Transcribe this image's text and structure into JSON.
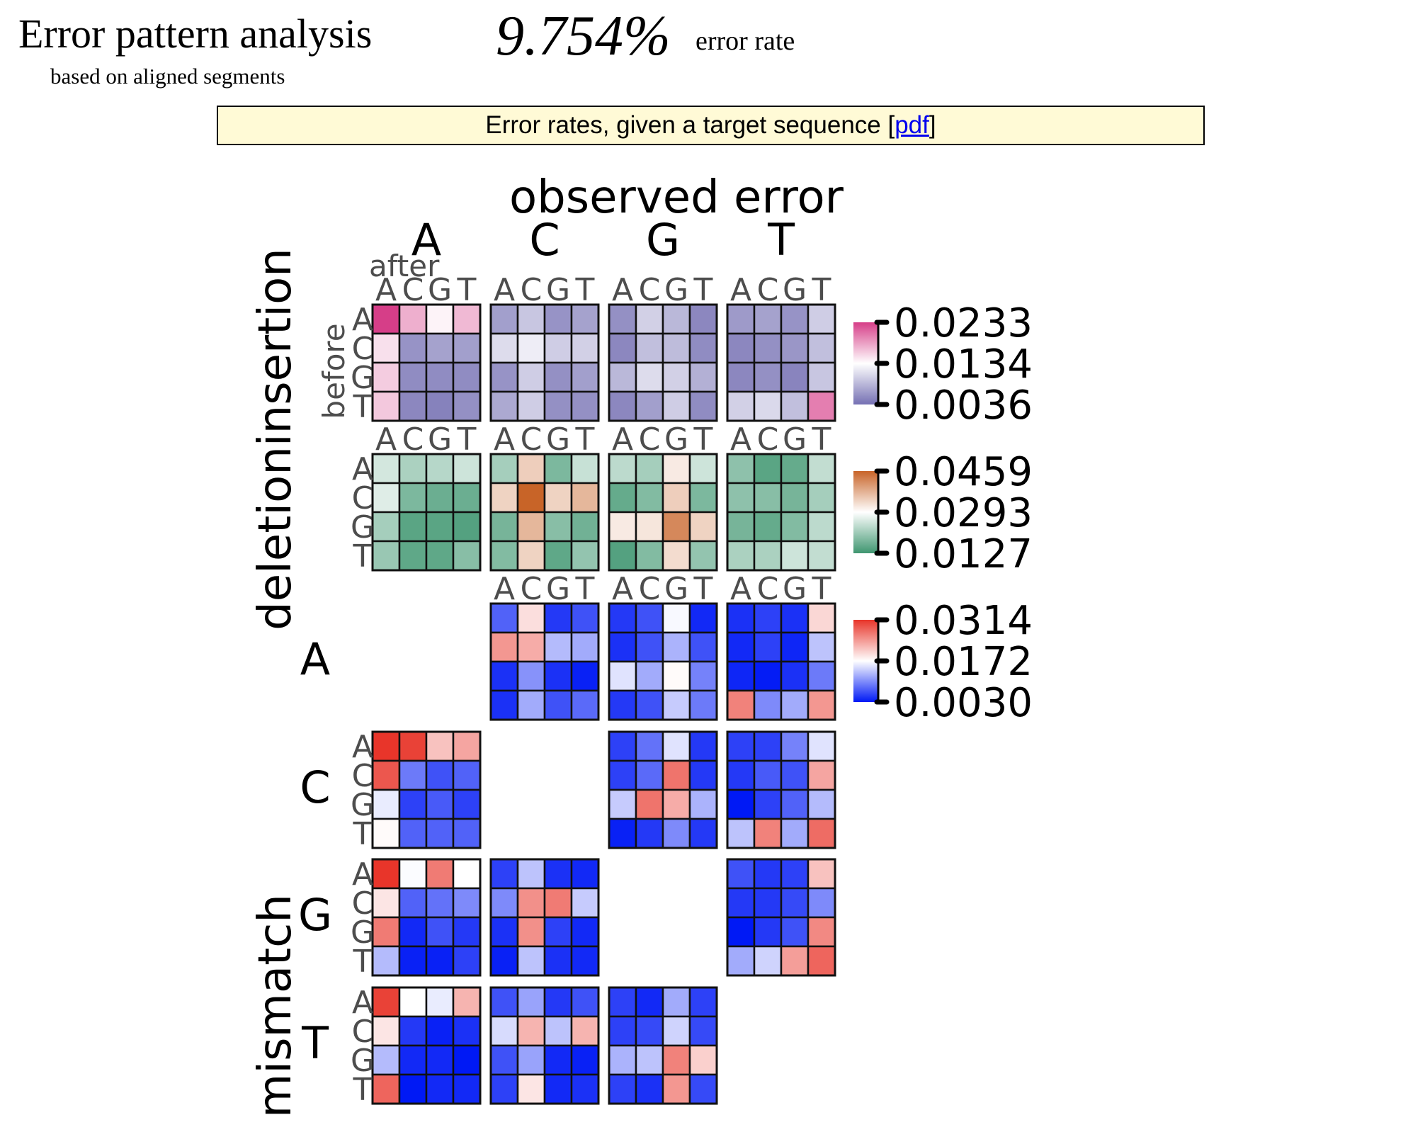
{
  "header": {
    "title": "Error pattern analysis",
    "subtitle": "based on aligned segments",
    "error_rate_value": "9.754%",
    "error_rate_label": "error rate"
  },
  "banner": {
    "text_before": "Error rates, given a target sequence [",
    "link_label": "pdf",
    "text_after": "]"
  },
  "chart_data": {
    "type": "heatmap",
    "title": "observed error",
    "column_labels": [
      "A",
      "C",
      "G",
      "T"
    ],
    "column_axis_label": "after",
    "row_axis_label": "before",
    "bases": [
      "A",
      "C",
      "G",
      "T"
    ],
    "row_groups": [
      {
        "name": "insertion",
        "group_label": "insertion"
      },
      {
        "name": "deletion",
        "group_label": "deletion"
      },
      {
        "name": "mismatch A",
        "group_label": "mismatch",
        "sub_label": "A"
      },
      {
        "name": "mismatch C",
        "group_label": "mismatch",
        "sub_label": "C"
      },
      {
        "name": "mismatch G",
        "group_label": "mismatch",
        "sub_label": "G"
      },
      {
        "name": "mismatch T",
        "group_label": "mismatch",
        "sub_label": "T"
      }
    ],
    "side_labels": {
      "top": "deletioninsertion",
      "bottom": "mismatch"
    },
    "scales": {
      "insertion": {
        "min": 0.0036,
        "mid": 0.0134,
        "max": 0.0233,
        "low_color": "#7570b3",
        "mid_color": "#ffffff",
        "high_color": "#d63e88",
        "ticks": [
          "0.0233",
          "0.0134",
          "0.0036"
        ]
      },
      "deletion": {
        "min": 0.0127,
        "mid": 0.0293,
        "max": 0.0459,
        "low_color": "#3f9670",
        "mid_color": "#ffffff",
        "high_color": "#c86428",
        "ticks": [
          "0.0459",
          "0.0293",
          "0.0127"
        ]
      },
      "mismatch": {
        "min": 0.003,
        "mid": 0.0172,
        "max": 0.0314,
        "low_color": "#0019f5",
        "mid_color": "#ffffff",
        "high_color": "#e8352a",
        "ticks": [
          "0.0314",
          "0.0172",
          "0.0030"
        ]
      }
    },
    "panels": {
      "insertion": {
        "A": [
          [
            0.0233,
            0.0175,
            0.014,
            0.017
          ],
          [
            0.015,
            0.006,
            0.007,
            0.0068
          ],
          [
            0.016,
            0.0055,
            0.0055,
            0.0055
          ],
          [
            0.0162,
            0.0052,
            0.0048,
            0.0058
          ]
        ],
        "C": [
          [
            0.0068,
            0.0095,
            0.006,
            0.007
          ],
          [
            0.011,
            0.0122,
            0.01,
            0.0102
          ],
          [
            0.006,
            0.01,
            0.0058,
            0.0068
          ],
          [
            0.0075,
            0.01,
            0.0058,
            0.0058
          ]
        ],
        "G": [
          [
            0.0058,
            0.0102,
            0.0085,
            0.0052
          ],
          [
            0.0052,
            0.009,
            0.0088,
            0.0055
          ],
          [
            0.0085,
            0.011,
            0.0102,
            0.008
          ],
          [
            0.0052,
            0.0068,
            0.01,
            0.0055
          ]
        ],
        "T": [
          [
            0.0065,
            0.007,
            0.006,
            0.01
          ],
          [
            0.0052,
            0.0058,
            0.0062,
            0.009
          ],
          [
            0.0052,
            0.0058,
            0.005,
            0.0095
          ],
          [
            0.0102,
            0.0108,
            0.009,
            0.02
          ]
        ]
      },
      "deletion": {
        "A": [
          [
            0.0255,
            0.022,
            0.023,
            0.025
          ],
          [
            0.0265,
            0.018,
            0.0165,
            0.0165
          ],
          [
            0.0215,
            0.015,
            0.015,
            0.0145
          ],
          [
            0.0205,
            0.0155,
            0.0155,
            0.019
          ]
        ],
        "C": [
          [
            0.0215,
            0.0345,
            0.018,
            0.0245
          ],
          [
            0.034,
            0.0459,
            0.034,
            0.037
          ],
          [
            0.0175,
            0.037,
            0.019,
            0.017
          ],
          [
            0.0185,
            0.034,
            0.0155,
            0.02
          ]
        ],
        "G": [
          [
            0.0235,
            0.0215,
            0.0315,
            0.025
          ],
          [
            0.016,
            0.0185,
            0.0345,
            0.018
          ],
          [
            0.0315,
            0.032,
            0.042,
            0.034
          ],
          [
            0.0145,
            0.0185,
            0.033,
            0.02
          ]
        ],
        "T": [
          [
            0.0195,
            0.015,
            0.016,
            0.024
          ],
          [
            0.0195,
            0.019,
            0.0175,
            0.0215
          ],
          [
            0.0175,
            0.016,
            0.0185,
            0.0235
          ],
          [
            0.022,
            0.022,
            0.025,
            0.024
          ]
        ]
      },
      "mismatch A": {
        "A": null,
        "C": [
          [
            0.0075,
            0.0195,
            0.005,
            0.0065
          ],
          [
            0.0245,
            0.023,
            0.013,
            0.012
          ],
          [
            0.0045,
            0.0105,
            0.0045,
            0.0035
          ],
          [
            0.0045,
            0.012,
            0.0065,
            0.008
          ]
        ],
        "G": [
          [
            0.005,
            0.0065,
            0.0168,
            0.004
          ],
          [
            0.0045,
            0.0065,
            0.0125,
            0.0065
          ],
          [
            0.0155,
            0.012,
            0.0175,
            0.0095
          ],
          [
            0.005,
            0.0065,
            0.014,
            0.009
          ]
        ],
        "T": [
          [
            0.0045,
            0.0055,
            0.0045,
            0.02
          ],
          [
            0.004,
            0.0055,
            0.0038,
            0.0135
          ],
          [
            0.0038,
            0.0032,
            0.0045,
            0.009
          ],
          [
            0.026,
            0.01,
            0.012,
            0.0245
          ]
        ]
      },
      "mismatch C": {
        "A": [
          [
            0.0314,
            0.0305,
            0.0215,
            0.0235
          ],
          [
            0.029,
            0.009,
            0.0065,
            0.0075
          ],
          [
            0.016,
            0.0055,
            0.007,
            0.0055
          ],
          [
            0.0175,
            0.0075,
            0.0075,
            0.0075
          ]
        ],
        "C": null,
        "G": [
          [
            0.0055,
            0.0085,
            0.0155,
            0.005
          ],
          [
            0.0055,
            0.008,
            0.027,
            0.005
          ],
          [
            0.014,
            0.027,
            0.023,
            0.0125
          ],
          [
            0.0035,
            0.005,
            0.01,
            0.005
          ]
        ],
        "T": [
          [
            0.0055,
            0.0055,
            0.0095,
            0.0155
          ],
          [
            0.005,
            0.007,
            0.0065,
            0.0235
          ],
          [
            0.003,
            0.0055,
            0.0075,
            0.013
          ],
          [
            0.0135,
            0.026,
            0.012,
            0.0275
          ]
        ]
      },
      "mismatch G": {
        "A": [
          [
            0.0314,
            0.017,
            0.0265,
            0.0172
          ],
          [
            0.019,
            0.0075,
            0.0085,
            0.01
          ],
          [
            0.0265,
            0.004,
            0.0065,
            0.005
          ],
          [
            0.013,
            0.0035,
            0.0035,
            0.0055
          ]
        ],
        "C": [
          [
            0.0055,
            0.0135,
            0.0045,
            0.004
          ],
          [
            0.01,
            0.025,
            0.0265,
            0.014
          ],
          [
            0.0045,
            0.025,
            0.0055,
            0.004
          ],
          [
            0.0035,
            0.0135,
            0.0045,
            0.004
          ]
        ],
        "G": null,
        "T": [
          [
            0.0065,
            0.005,
            0.0055,
            0.0215
          ],
          [
            0.005,
            0.005,
            0.006,
            0.01
          ],
          [
            0.003,
            0.005,
            0.0065,
            0.0255
          ],
          [
            0.012,
            0.0145,
            0.024,
            0.028
          ]
        ]
      },
      "mismatch T": {
        "A": [
          [
            0.0305,
            0.0172,
            0.016,
            0.0225
          ],
          [
            0.019,
            0.005,
            0.0035,
            0.0045
          ],
          [
            0.013,
            0.004,
            0.004,
            0.003
          ],
          [
            0.028,
            0.003,
            0.004,
            0.004
          ]
        ],
        "C": [
          [
            0.0065,
            0.0115,
            0.005,
            0.0065
          ],
          [
            0.015,
            0.0225,
            0.0135,
            0.0225
          ],
          [
            0.0065,
            0.0115,
            0.004,
            0.0035
          ],
          [
            0.0055,
            0.019,
            0.004,
            0.0045
          ]
        ],
        "G": [
          [
            0.0055,
            0.004,
            0.012,
            0.0055
          ],
          [
            0.0055,
            0.006,
            0.0145,
            0.006
          ],
          [
            0.0125,
            0.0135,
            0.026,
            0.0205
          ],
          [
            0.0055,
            0.0045,
            0.0245,
            0.006
          ]
        ],
        "T": null
      }
    }
  }
}
